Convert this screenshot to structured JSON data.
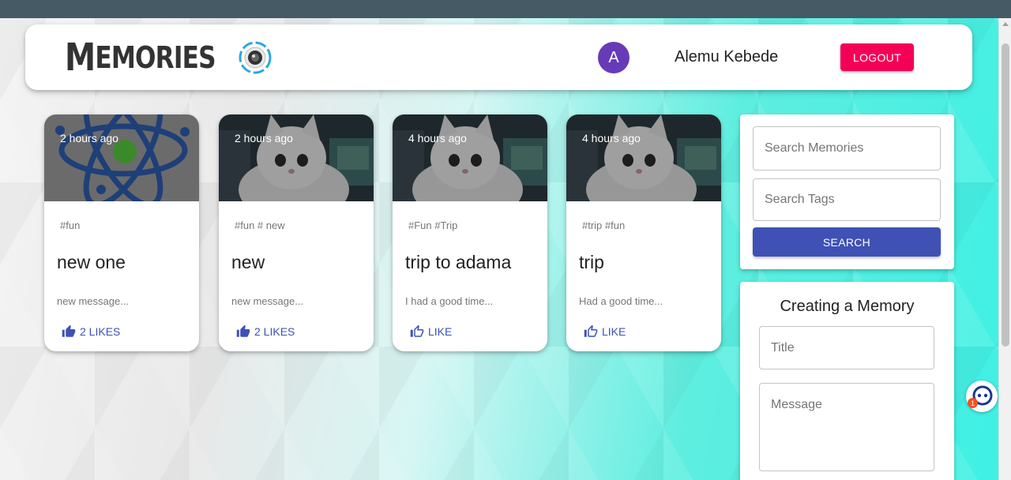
{
  "header": {
    "brand_big": "M",
    "brand_rest": "EMORIES",
    "avatar_letter": "A",
    "user_name": "Alemu Kebede",
    "logout_label": "LOGOUT"
  },
  "posts": [
    {
      "time": "2 hours ago",
      "tags": "#fun",
      "title": "new one",
      "message": "new message...",
      "likes": "2 LIKES",
      "image": "atom-logo"
    },
    {
      "time": "2 hours ago",
      "tags": "#fun # new",
      "title": "new",
      "message": "new message...",
      "likes": "2 LIKES",
      "image": "cat-photo"
    },
    {
      "time": "4 hours ago",
      "tags": "#Fun #Trip",
      "title": "trip to adama",
      "message": "I had a good time...",
      "likes": "LIKE",
      "image": "cat-photo"
    },
    {
      "time": "4 hours ago",
      "tags": "#trip #fun",
      "title": "trip",
      "message": "Had a good time...",
      "likes": "LIKE",
      "image": "cat-photo"
    }
  ],
  "search": {
    "memories_placeholder": "Search Memories",
    "tags_placeholder": "Search Tags",
    "button_label": "SEARCH"
  },
  "form": {
    "title": "Creating a Memory",
    "title_placeholder": "Title",
    "message_placeholder": "Message"
  },
  "helper_badge": "1",
  "colors": {
    "primary": "#3f51b5",
    "secondary": "#f50057",
    "avatar": "#673ab7",
    "topbar": "#455a64"
  }
}
